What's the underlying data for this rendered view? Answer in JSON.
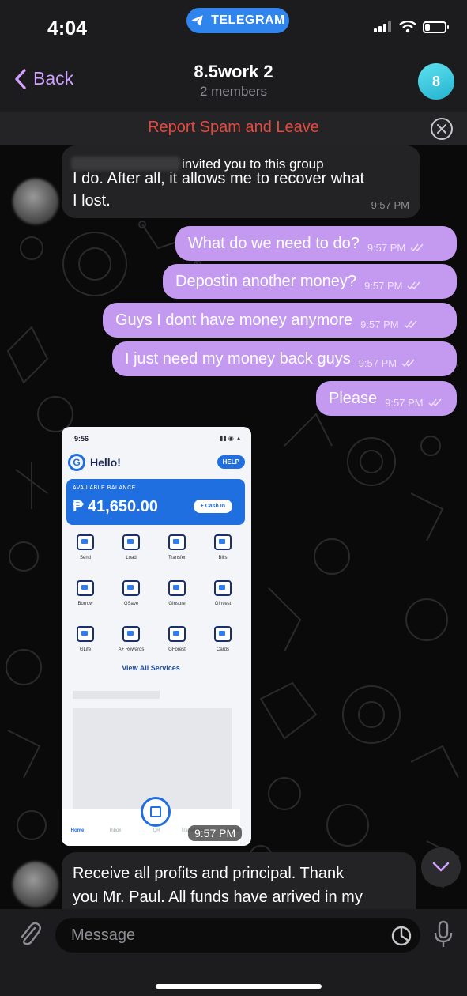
{
  "status_bar": {
    "time": "4:04",
    "app_pill": "TELEGRAM",
    "battery_level": 0.25
  },
  "header": {
    "back_label": "Back",
    "title": "8.5work 2",
    "subtitle": "2 members",
    "avatar_initial": "8",
    "avatar_color": "#3cc8e0"
  },
  "spam_bar": {
    "label": "Report Spam and Leave"
  },
  "messages": [
    {
      "direction": "in",
      "system_overlay": "invited you to this group",
      "text_line1": "I do. After all, it allows me to recover what",
      "text_line2": "I lost.",
      "time": "9:57 PM"
    },
    {
      "direction": "out",
      "text": "What do we need to do?",
      "time": "9:57 PM"
    },
    {
      "direction": "out",
      "text": "Depostin another money?",
      "time": "9:57 PM"
    },
    {
      "direction": "out",
      "text": "Guys I dont have money anymore",
      "time": "9:57 PM"
    },
    {
      "direction": "out",
      "text": "I just need my money back guys",
      "time": "9:57 PM"
    },
    {
      "direction": "out",
      "text": "Please",
      "time": "9:57 PM"
    },
    {
      "direction": "in",
      "text_line1": "Receive all profits and principal. Thank",
      "text_line2": "you Mr. Paul. All funds have arrived in my"
    }
  ],
  "image_message": {
    "time": "9:57 PM",
    "screenshot": {
      "status_time": "9:56",
      "hello": "Hello!",
      "help": "HELP",
      "available_balance_label": "AVAILABLE BALANCE",
      "balance": "₱ 41,650.00",
      "cash_in": "+ Cash In",
      "services": [
        "Send",
        "Load",
        "Transfer",
        "Bills",
        "Borrow",
        "GSave",
        "GInsure",
        "GInvest",
        "GLife",
        "A+ Rewards",
        "GForest",
        "Cards"
      ],
      "view_all": "View All Services",
      "tabs": [
        "Home",
        "Inbox",
        "QR",
        "Transactions",
        "Profile"
      ]
    }
  },
  "input_bar": {
    "placeholder": "Message"
  },
  "colors": {
    "accent": "#d0a1ff",
    "outgoing_bubble": "#c49af0",
    "incoming_bubble": "#232325",
    "spam_red": "#e6493e",
    "telegram_blue": "#2f84ee"
  }
}
